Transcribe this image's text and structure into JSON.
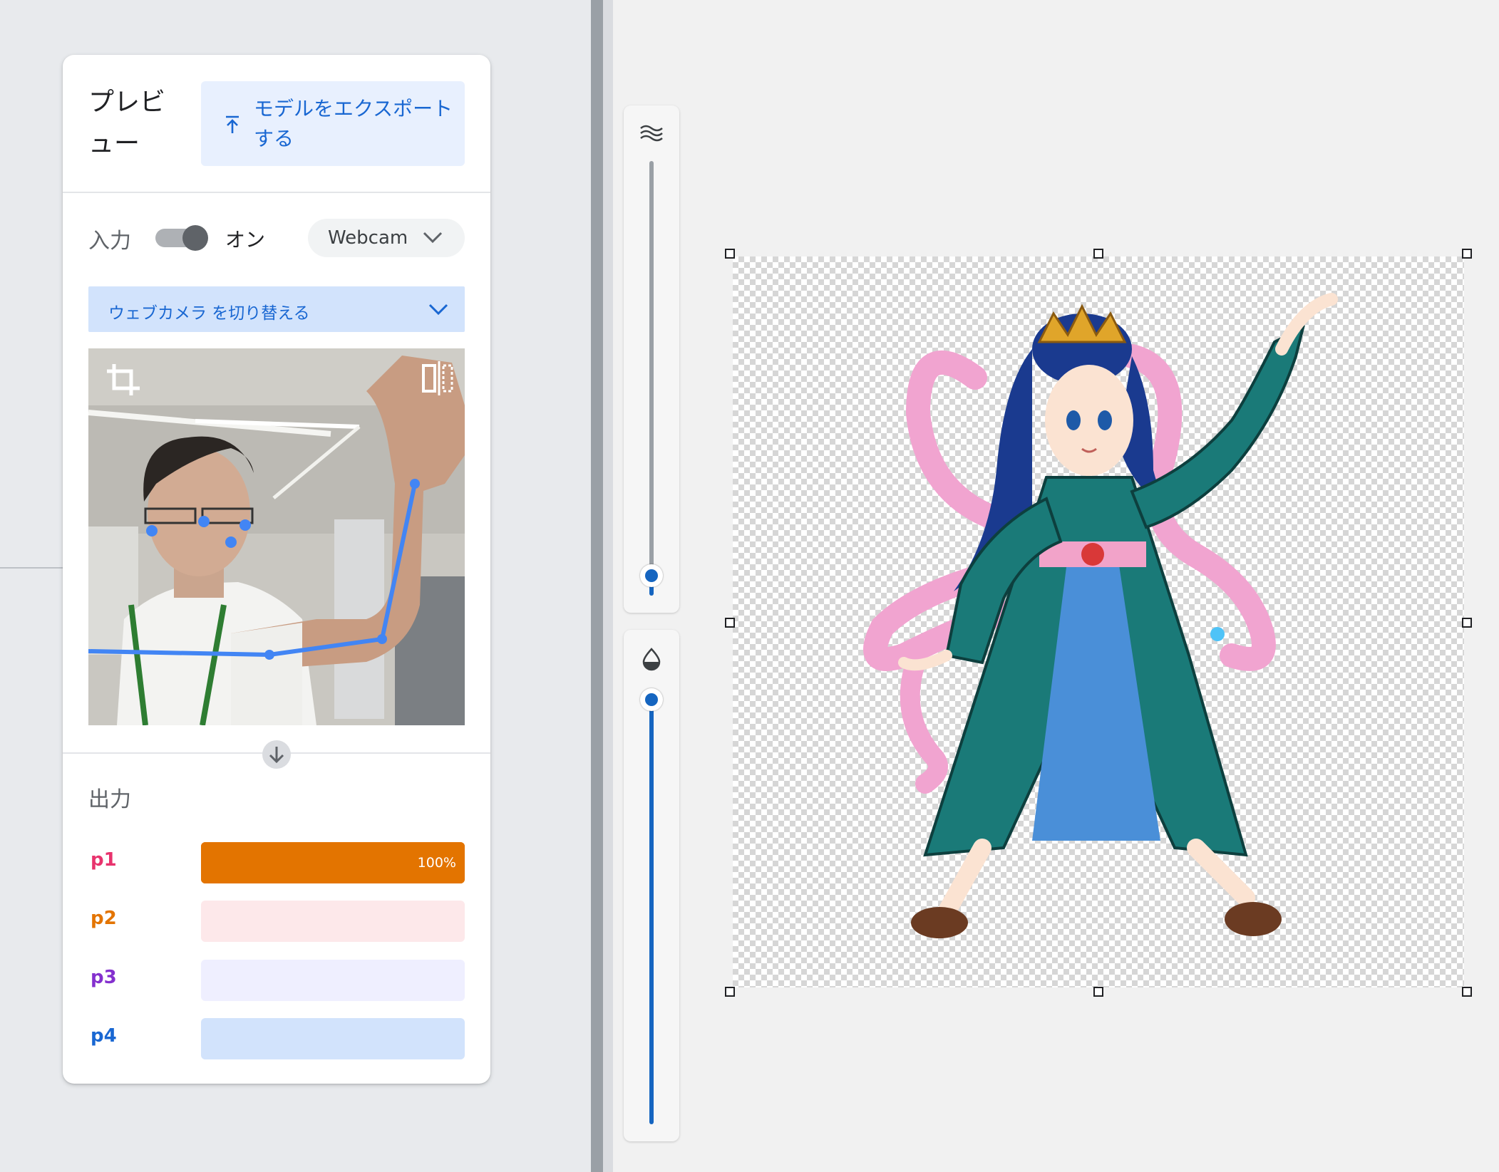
{
  "preview": {
    "title": "プレビュー",
    "export_label": "モデルをエクスポートする",
    "export_icon": "upload-icon"
  },
  "input": {
    "label": "入力",
    "toggle_state": "オン",
    "source": "Webcam",
    "switch_camera_label": "ウェブカメラ を切り替える",
    "crop_icon": "crop-icon",
    "flip_icon": "flip-icon"
  },
  "output": {
    "label": "出力",
    "classes": [
      {
        "name": "p1",
        "percent_label": "100%",
        "value": 1.0,
        "name_color": "#e8336d",
        "bar_bg": "#e37400",
        "fill_color": "#e37400"
      },
      {
        "name": "p2",
        "percent_label": "",
        "value": 0.0,
        "name_color": "#e37400",
        "bar_bg": "#fde8ea",
        "fill_color": "#e37400"
      },
      {
        "name": "p3",
        "percent_label": "",
        "value": 0.0,
        "name_color": "#8430ce",
        "bar_bg": "#efefff",
        "fill_color": "#8430ce"
      },
      {
        "name": "p4",
        "percent_label": "",
        "value": 0.0,
        "name_color": "#1967d2",
        "bar_bg": "#d2e3fc",
        "fill_color": "#1967d2"
      }
    ]
  },
  "sliders": {
    "top": {
      "icon": "waves-icon",
      "value": 0.0
    },
    "bottom": {
      "icon": "opacity-icon",
      "value": 1.0
    }
  },
  "colors": {
    "accent": "#1967d2",
    "slider_active": "#1565c0"
  }
}
